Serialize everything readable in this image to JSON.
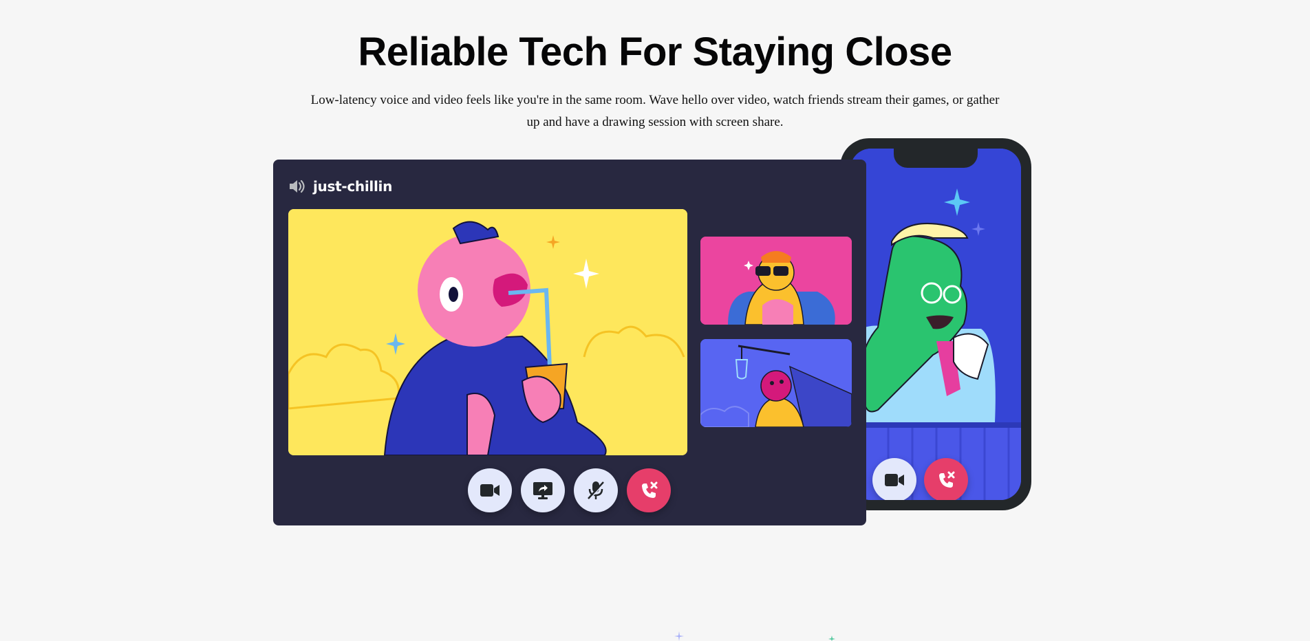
{
  "hero": {
    "title": "Reliable Tech For Staying Close",
    "description": "Low-latency voice and video feels like you're in the same room. Wave hello over video, watch friends stream their games, or gather up and have a drawing session with screen share."
  },
  "call_window": {
    "channel_icon": "speaker-icon",
    "channel_name": "just-chillin",
    "controls": [
      {
        "icon": "video-camera-icon",
        "action": "toggle-video"
      },
      {
        "icon": "screen-share-icon",
        "action": "share-screen"
      },
      {
        "icon": "mic-muted-icon",
        "action": "toggle-mute"
      },
      {
        "icon": "hang-up-icon",
        "action": "end-call"
      }
    ]
  },
  "phone_call": {
    "controls": [
      {
        "icon": "video-camera-icon",
        "action": "toggle-video"
      },
      {
        "icon": "hang-up-icon",
        "action": "end-call"
      }
    ]
  },
  "colors": {
    "background": "#f6f6f6",
    "window": "#282840",
    "yellow_tile": "#fee75c",
    "pink_tile": "#eb459f",
    "blurple_tile": "#5865f2",
    "phone_screen": "#3545d6",
    "control_button": "#e3e8fb",
    "hangup_button": "#e63e6a"
  }
}
